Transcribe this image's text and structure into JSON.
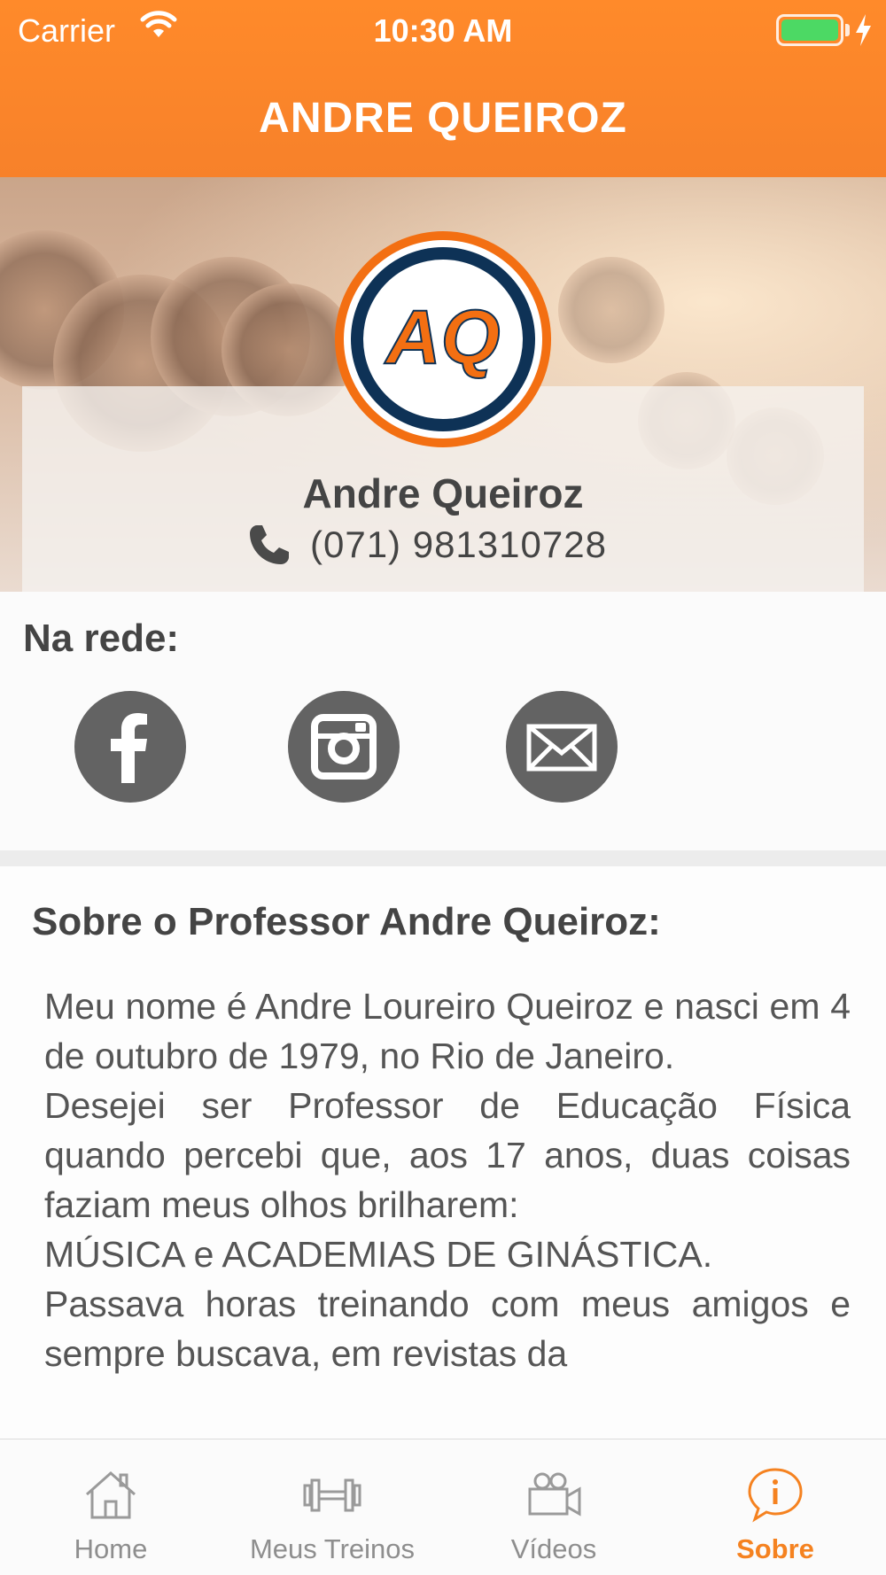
{
  "status_bar": {
    "carrier": "Carrier",
    "time": "10:30 AM",
    "battery_color": "#4cd964"
  },
  "nav": {
    "title": "ANDRE QUEIROZ",
    "background_color": "#f7812a"
  },
  "profile": {
    "logo_text": "AQ",
    "name": "Andre Queiroz",
    "phone": "(071) 981310728",
    "phone_icon": "phone-icon"
  },
  "social": {
    "title": "Na rede:",
    "buttons": [
      {
        "name": "facebook",
        "icon": "facebook-icon"
      },
      {
        "name": "instagram",
        "icon": "instagram-icon"
      },
      {
        "name": "email",
        "icon": "mail-icon"
      }
    ]
  },
  "about": {
    "title": "Sobre o Professor Andre Queiroz:",
    "text": "Meu nome é Andre Loureiro Queiroz e nasci em 4 de outubro de 1979, no Rio de Janeiro.\nDesejei ser Professor de Educação Física quando percebi que, aos 17 anos, duas coisas faziam meus olhos brilharem:\nMÚSICA e ACADEMIAS DE GINÁSTICA.\nPassava horas treinando com meus amigos e sempre buscava, em revistas da"
  },
  "tabbar": {
    "accent_color": "#f58220",
    "tabs": [
      {
        "label": "Home",
        "icon": "house-icon",
        "active": false
      },
      {
        "label": "Meus Treinos",
        "icon": "dumbbell-icon",
        "active": false
      },
      {
        "label": "Vídeos",
        "icon": "video-camera-icon",
        "active": false
      },
      {
        "label": "Sobre",
        "icon": "info-icon",
        "active": true
      }
    ]
  }
}
